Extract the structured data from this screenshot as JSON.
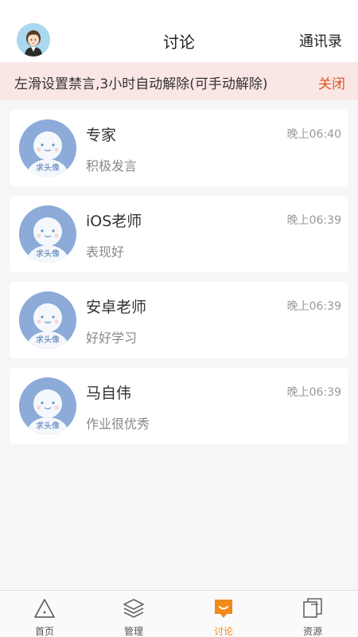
{
  "header": {
    "title": "讨论",
    "contacts_label": "通讯录"
  },
  "notice": {
    "text": "左滑设置禁言,3小时自动解除(可手动解除)",
    "close_label": "关闭"
  },
  "avatar_placeholder": "求头像",
  "conversations": [
    {
      "name": "专家",
      "message": "积极发言",
      "time": "晚上06:40"
    },
    {
      "name": "iOS老师",
      "message": "表现好",
      "time": "晚上06:39"
    },
    {
      "name": "安卓老师",
      "message": "好好学习",
      "time": "晚上06:39"
    },
    {
      "name": "马自伟",
      "message": "作业很优秀",
      "time": "晚上06:39"
    }
  ],
  "tabs": [
    {
      "label": "首页",
      "icon": "triangle-icon"
    },
    {
      "label": "管理",
      "icon": "layers-icon"
    },
    {
      "label": "讨论",
      "icon": "chat-bubble-icon",
      "active": true
    },
    {
      "label": "资源",
      "icon": "documents-icon"
    }
  ],
  "colors": {
    "accent": "#f08a1a",
    "notice_bg": "#fbe6e6",
    "close": "#e0531e",
    "avatar": "#8cabd8"
  }
}
